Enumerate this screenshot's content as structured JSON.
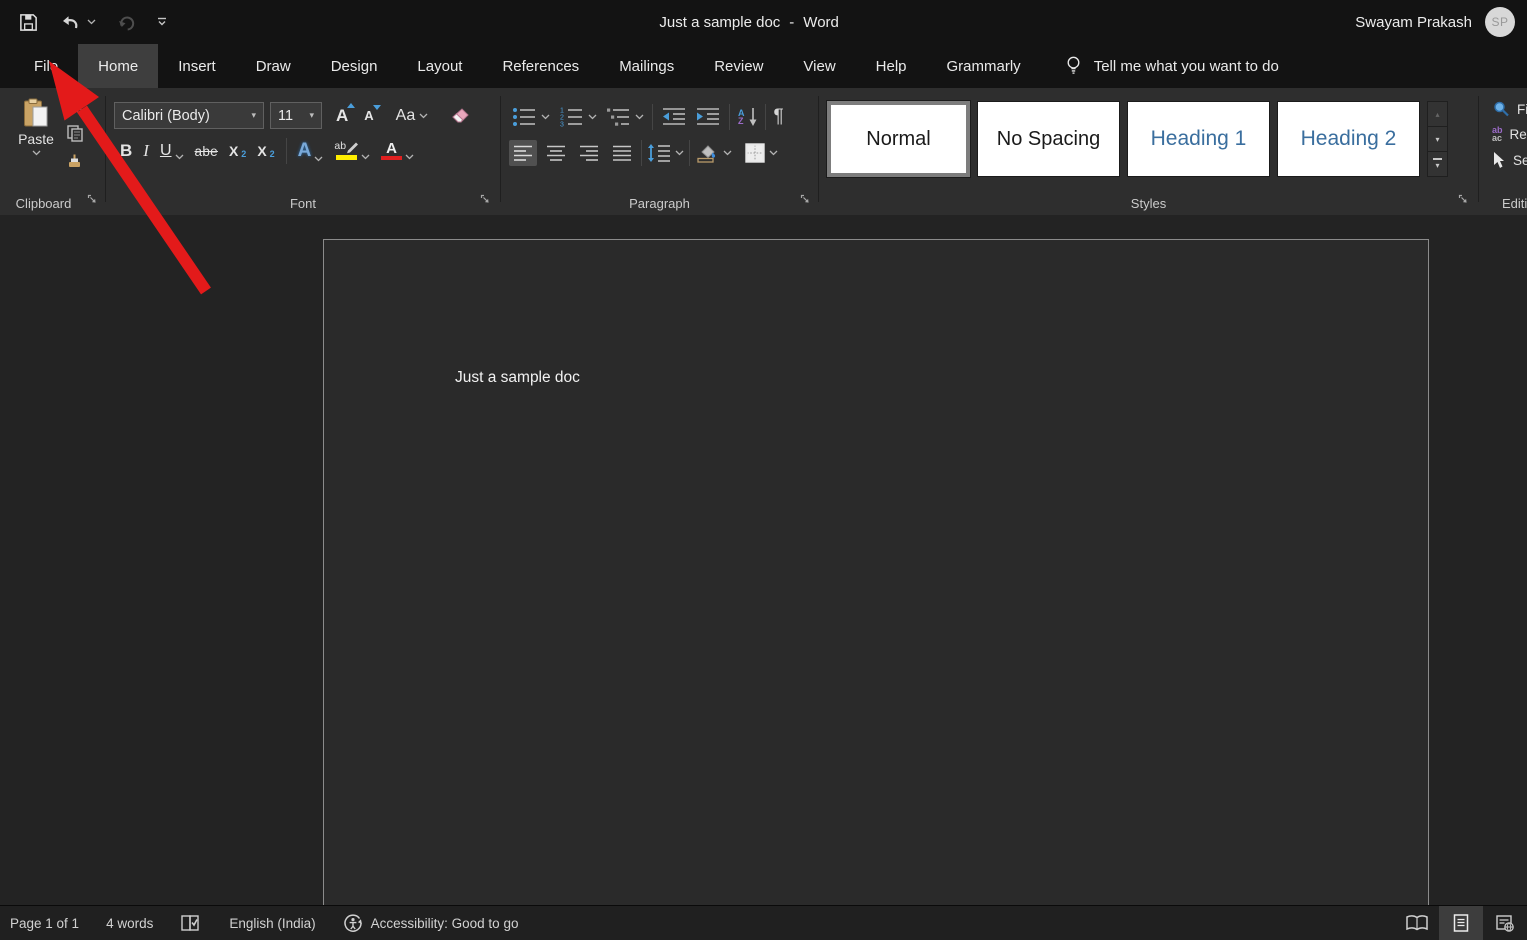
{
  "titlebar": {
    "title_doc": "Just a sample doc",
    "title_sep": "-",
    "title_app": "Word",
    "user_name": "Swayam Prakash",
    "user_initials": "SP"
  },
  "menubar": {
    "tabs": [
      {
        "label": "File",
        "active": false
      },
      {
        "label": "Home",
        "active": true
      },
      {
        "label": "Insert",
        "active": false
      },
      {
        "label": "Draw",
        "active": false
      },
      {
        "label": "Design",
        "active": false
      },
      {
        "label": "Layout",
        "active": false
      },
      {
        "label": "References",
        "active": false
      },
      {
        "label": "Mailings",
        "active": false
      },
      {
        "label": "Review",
        "active": false
      },
      {
        "label": "View",
        "active": false
      },
      {
        "label": "Help",
        "active": false
      },
      {
        "label": "Grammarly",
        "active": false
      }
    ],
    "tell_me": "Tell me what you want to do"
  },
  "ribbon": {
    "clipboard": {
      "group_label": "Clipboard",
      "paste_label": "Paste"
    },
    "font": {
      "group_label": "Font",
      "font_name": "Calibri (Body)",
      "font_size": "11",
      "grow_font": "A",
      "shrink_font": "A",
      "change_case": "Aa",
      "bold": "B",
      "italic": "I",
      "underline": "U",
      "strikethrough": "abe",
      "subscript_base": "X",
      "subscript_small": "2",
      "superscript_base": "X",
      "superscript_small": "2",
      "text_effects": "A",
      "highlight_letters": "ab",
      "font_color_letter": "A"
    },
    "paragraph": {
      "group_label": "Paragraph",
      "sort_a": "A",
      "sort_z": "Z",
      "pilcrow": "¶"
    },
    "styles": {
      "group_label": "Styles",
      "items": [
        {
          "label": "Normal",
          "selected": true,
          "color": "#1a1a1a"
        },
        {
          "label": "No Spacing",
          "selected": false,
          "color": "#1a1a1a"
        },
        {
          "label": "Heading 1",
          "selected": false,
          "color": "#3a6e9e"
        },
        {
          "label": "Heading 2",
          "selected": false,
          "color": "#3a6e9e"
        }
      ]
    },
    "editing": {
      "group_label": "Editing",
      "find_label": "Find",
      "replace_label": "Replace",
      "select_label": "Select",
      "replace_ab": "ab",
      "replace_ac": "ac"
    }
  },
  "document": {
    "body_text": "Just a sample doc"
  },
  "statusbar": {
    "page_info": "Page 1 of 1",
    "word_count": "4 words",
    "language": "English (India)",
    "accessibility": "Accessibility: Good to go"
  },
  "icons": {
    "dropdown": "▾",
    "scroll_up": "▴",
    "scroll_down": "▾"
  },
  "colors": {
    "accent_blue": "#4a9edb",
    "heading_blue": "#3a6e9e",
    "highlight_yellow": "#ffee00",
    "font_color_red": "#e02020",
    "arrow_red": "#e31a1a",
    "clipboard_tan": "#c9a365"
  }
}
